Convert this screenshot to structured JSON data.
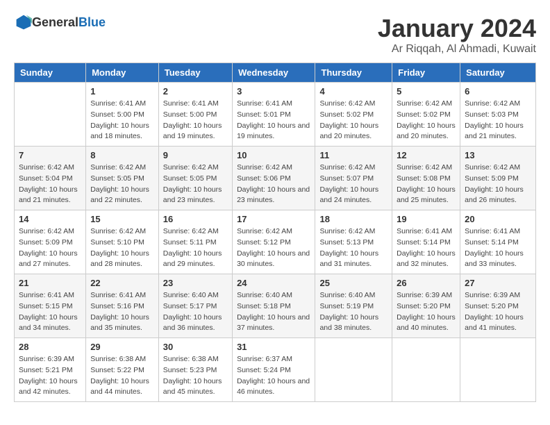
{
  "logo": {
    "general": "General",
    "blue": "Blue"
  },
  "title": "January 2024",
  "location": "Ar Riqqah, Al Ahmadi, Kuwait",
  "days_header": [
    "Sunday",
    "Monday",
    "Tuesday",
    "Wednesday",
    "Thursday",
    "Friday",
    "Saturday"
  ],
  "weeks": [
    [
      {
        "day": "",
        "sunrise": "",
        "sunset": "",
        "daylight": ""
      },
      {
        "day": "1",
        "sunrise": "Sunrise: 6:41 AM",
        "sunset": "Sunset: 5:00 PM",
        "daylight": "Daylight: 10 hours and 18 minutes."
      },
      {
        "day": "2",
        "sunrise": "Sunrise: 6:41 AM",
        "sunset": "Sunset: 5:00 PM",
        "daylight": "Daylight: 10 hours and 19 minutes."
      },
      {
        "day": "3",
        "sunrise": "Sunrise: 6:41 AM",
        "sunset": "Sunset: 5:01 PM",
        "daylight": "Daylight: 10 hours and 19 minutes."
      },
      {
        "day": "4",
        "sunrise": "Sunrise: 6:42 AM",
        "sunset": "Sunset: 5:02 PM",
        "daylight": "Daylight: 10 hours and 20 minutes."
      },
      {
        "day": "5",
        "sunrise": "Sunrise: 6:42 AM",
        "sunset": "Sunset: 5:02 PM",
        "daylight": "Daylight: 10 hours and 20 minutes."
      },
      {
        "day": "6",
        "sunrise": "Sunrise: 6:42 AM",
        "sunset": "Sunset: 5:03 PM",
        "daylight": "Daylight: 10 hours and 21 minutes."
      }
    ],
    [
      {
        "day": "7",
        "sunrise": "Sunrise: 6:42 AM",
        "sunset": "Sunset: 5:04 PM",
        "daylight": "Daylight: 10 hours and 21 minutes."
      },
      {
        "day": "8",
        "sunrise": "Sunrise: 6:42 AM",
        "sunset": "Sunset: 5:05 PM",
        "daylight": "Daylight: 10 hours and 22 minutes."
      },
      {
        "day": "9",
        "sunrise": "Sunrise: 6:42 AM",
        "sunset": "Sunset: 5:05 PM",
        "daylight": "Daylight: 10 hours and 23 minutes."
      },
      {
        "day": "10",
        "sunrise": "Sunrise: 6:42 AM",
        "sunset": "Sunset: 5:06 PM",
        "daylight": "Daylight: 10 hours and 23 minutes."
      },
      {
        "day": "11",
        "sunrise": "Sunrise: 6:42 AM",
        "sunset": "Sunset: 5:07 PM",
        "daylight": "Daylight: 10 hours and 24 minutes."
      },
      {
        "day": "12",
        "sunrise": "Sunrise: 6:42 AM",
        "sunset": "Sunset: 5:08 PM",
        "daylight": "Daylight: 10 hours and 25 minutes."
      },
      {
        "day": "13",
        "sunrise": "Sunrise: 6:42 AM",
        "sunset": "Sunset: 5:09 PM",
        "daylight": "Daylight: 10 hours and 26 minutes."
      }
    ],
    [
      {
        "day": "14",
        "sunrise": "Sunrise: 6:42 AM",
        "sunset": "Sunset: 5:09 PM",
        "daylight": "Daylight: 10 hours and 27 minutes."
      },
      {
        "day": "15",
        "sunrise": "Sunrise: 6:42 AM",
        "sunset": "Sunset: 5:10 PM",
        "daylight": "Daylight: 10 hours and 28 minutes."
      },
      {
        "day": "16",
        "sunrise": "Sunrise: 6:42 AM",
        "sunset": "Sunset: 5:11 PM",
        "daylight": "Daylight: 10 hours and 29 minutes."
      },
      {
        "day": "17",
        "sunrise": "Sunrise: 6:42 AM",
        "sunset": "Sunset: 5:12 PM",
        "daylight": "Daylight: 10 hours and 30 minutes."
      },
      {
        "day": "18",
        "sunrise": "Sunrise: 6:42 AM",
        "sunset": "Sunset: 5:13 PM",
        "daylight": "Daylight: 10 hours and 31 minutes."
      },
      {
        "day": "19",
        "sunrise": "Sunrise: 6:41 AM",
        "sunset": "Sunset: 5:14 PM",
        "daylight": "Daylight: 10 hours and 32 minutes."
      },
      {
        "day": "20",
        "sunrise": "Sunrise: 6:41 AM",
        "sunset": "Sunset: 5:14 PM",
        "daylight": "Daylight: 10 hours and 33 minutes."
      }
    ],
    [
      {
        "day": "21",
        "sunrise": "Sunrise: 6:41 AM",
        "sunset": "Sunset: 5:15 PM",
        "daylight": "Daylight: 10 hours and 34 minutes."
      },
      {
        "day": "22",
        "sunrise": "Sunrise: 6:41 AM",
        "sunset": "Sunset: 5:16 PM",
        "daylight": "Daylight: 10 hours and 35 minutes."
      },
      {
        "day": "23",
        "sunrise": "Sunrise: 6:40 AM",
        "sunset": "Sunset: 5:17 PM",
        "daylight": "Daylight: 10 hours and 36 minutes."
      },
      {
        "day": "24",
        "sunrise": "Sunrise: 6:40 AM",
        "sunset": "Sunset: 5:18 PM",
        "daylight": "Daylight: 10 hours and 37 minutes."
      },
      {
        "day": "25",
        "sunrise": "Sunrise: 6:40 AM",
        "sunset": "Sunset: 5:19 PM",
        "daylight": "Daylight: 10 hours and 38 minutes."
      },
      {
        "day": "26",
        "sunrise": "Sunrise: 6:39 AM",
        "sunset": "Sunset: 5:20 PM",
        "daylight": "Daylight: 10 hours and 40 minutes."
      },
      {
        "day": "27",
        "sunrise": "Sunrise: 6:39 AM",
        "sunset": "Sunset: 5:20 PM",
        "daylight": "Daylight: 10 hours and 41 minutes."
      }
    ],
    [
      {
        "day": "28",
        "sunrise": "Sunrise: 6:39 AM",
        "sunset": "Sunset: 5:21 PM",
        "daylight": "Daylight: 10 hours and 42 minutes."
      },
      {
        "day": "29",
        "sunrise": "Sunrise: 6:38 AM",
        "sunset": "Sunset: 5:22 PM",
        "daylight": "Daylight: 10 hours and 44 minutes."
      },
      {
        "day": "30",
        "sunrise": "Sunrise: 6:38 AM",
        "sunset": "Sunset: 5:23 PM",
        "daylight": "Daylight: 10 hours and 45 minutes."
      },
      {
        "day": "31",
        "sunrise": "Sunrise: 6:37 AM",
        "sunset": "Sunset: 5:24 PM",
        "daylight": "Daylight: 10 hours and 46 minutes."
      },
      {
        "day": "",
        "sunrise": "",
        "sunset": "",
        "daylight": ""
      },
      {
        "day": "",
        "sunrise": "",
        "sunset": "",
        "daylight": ""
      },
      {
        "day": "",
        "sunrise": "",
        "sunset": "",
        "daylight": ""
      }
    ]
  ]
}
